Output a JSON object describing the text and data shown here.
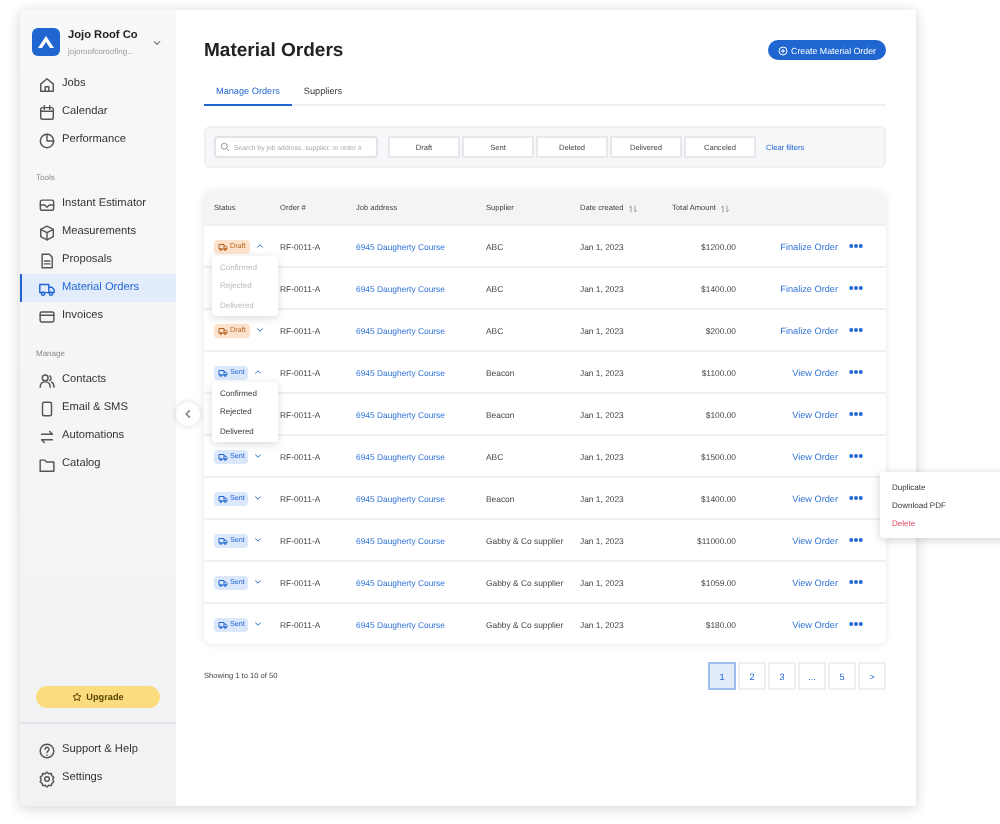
{
  "sidebar": {
    "company": "Jojo Roof Co",
    "subtitle": "jojoroofcoroofing...",
    "sections": [
      {
        "items": [
          {
            "label": "Jobs",
            "selected": false
          },
          {
            "label": "Calendar",
            "selected": false
          },
          {
            "label": "Performance",
            "selected": false
          }
        ]
      },
      {
        "heading": "Tools",
        "items": [
          {
            "label": "Instant Estimator",
            "selected": false
          },
          {
            "label": "Measurements",
            "selected": false
          },
          {
            "label": "Proposals",
            "selected": false
          },
          {
            "label": "Material Orders",
            "selected": true
          },
          {
            "label": "Invoices",
            "selected": false
          }
        ]
      },
      {
        "heading": "Manage",
        "items": [
          {
            "label": "Contacts",
            "selected": false
          },
          {
            "label": "Email & SMS",
            "selected": false
          },
          {
            "label": "Automations",
            "selected": false
          },
          {
            "label": "Catalog",
            "selected": false
          }
        ]
      }
    ],
    "upgrade": "Upgrade",
    "footer": [
      {
        "label": "Support & Help"
      },
      {
        "label": "Settings"
      }
    ]
  },
  "header": {
    "title": "Material Orders",
    "button": "Create Material Order"
  },
  "tabs": [
    {
      "label": "Manage Orders",
      "selected": true
    },
    {
      "label": "Suppliers",
      "selected": false
    }
  ],
  "filters": {
    "placeholder": "Search by job address, supplier, or order #",
    "options": [
      {
        "label": "Draft",
        "selected": false
      },
      {
        "label": "Sent",
        "selected": false
      },
      {
        "label": "Deleted",
        "selected": false
      },
      {
        "label": "Delivered",
        "selected": false
      },
      {
        "label": "Canceled",
        "selected": false
      }
    ],
    "clear": "Clear filters"
  },
  "table": {
    "columns": [
      {
        "label": "Status",
        "sortable": false
      },
      {
        "label": "Order #",
        "sortable": false
      },
      {
        "label": "Job address",
        "sortable": false
      },
      {
        "label": "Supplier",
        "sortable": false
      },
      {
        "label": "Date created",
        "sortable": true
      },
      {
        "label": "Total Amount",
        "sortable": true
      }
    ],
    "rows": [
      {
        "status": {
          "kind": "draft",
          "label": "Draft"
        },
        "expanded": true,
        "menu": [
          {
            "label": "Confirmed",
            "disabled": true
          },
          {
            "label": "Rejected",
            "disabled": true
          },
          {
            "label": "Delivered",
            "disabled": true
          }
        ],
        "order": "RF-0011-A",
        "address": "6945 Daugherty Course",
        "supplier": "ABC",
        "date": "Jan 1, 2023",
        "amount": "$1200.00",
        "action": "Finalize Order"
      },
      {
        "order": "RF-0011-A",
        "address": "6945 Daugherty Course",
        "supplier": "ABC",
        "date": "Jan 1, 2023",
        "amount": "$1400.00",
        "action": "Finalize Order"
      },
      {
        "status": {
          "kind": "draft",
          "label": "Draft"
        },
        "expanded": false,
        "order": "RF-0011-A",
        "address": "6945 Daugherty Course",
        "supplier": "ABC",
        "date": "Jan 1, 2023",
        "amount": "$200.00",
        "action": "Finalize Order"
      },
      {
        "status": {
          "kind": "sent",
          "label": "Sent"
        },
        "expanded": true,
        "menu": [
          {
            "label": "Confirmed",
            "disabled": false
          },
          {
            "label": "Rejected",
            "disabled": false
          },
          {
            "label": "Delivered",
            "disabled": false
          }
        ],
        "order": "RF-0011-A",
        "address": "6945 Daugherty Course",
        "supplier": "Beacon",
        "date": "Jan 1, 2023",
        "amount": "$1100.00",
        "action": "View Order"
      },
      {
        "order": "RF-0011-A",
        "address": "6945 Daugherty Course",
        "supplier": "Beacon",
        "date": "Jan 1, 2023",
        "amount": "$100.00",
        "action": "View Order"
      },
      {
        "status": {
          "kind": "sent",
          "label": "Sent"
        },
        "expanded": false,
        "order": "RF-0011-A",
        "address": "6945 Daugherty Course",
        "supplier": "ABC",
        "date": "Jan 1, 2023",
        "amount": "$1500.00",
        "action": "View Order",
        "actions_menu": [
          {
            "label": "Duplicate",
            "kind": "normal"
          },
          {
            "label": "Download PDF",
            "kind": "normal"
          },
          {
            "label": "Delete",
            "kind": "danger"
          }
        ]
      },
      {
        "status": {
          "kind": "sent",
          "label": "Sent"
        },
        "expanded": false,
        "order": "RF-0011-A",
        "address": "6945 Daugherty Course",
        "supplier": "Beacon",
        "date": "Jan 1, 2023",
        "amount": "$1400.00",
        "action": "View Order"
      },
      {
        "status": {
          "kind": "sent",
          "label": "Sent"
        },
        "expanded": false,
        "order": "RF-0011-A",
        "address": "6945 Daugherty Course",
        "supplier": "Gabby & Co supplier",
        "date": "Jan 1, 2023",
        "amount": "$11000.00",
        "action": "View Order"
      },
      {
        "status": {
          "kind": "sent",
          "label": "Sent"
        },
        "expanded": false,
        "order": "RF-0011-A",
        "address": "6945 Daugherty Course",
        "supplier": "Gabby & Co supplier",
        "date": "Jan 1, 2023",
        "amount": "$1059.00",
        "action": "View Order"
      },
      {
        "status": {
          "kind": "sent",
          "label": "Sent"
        },
        "expanded": false,
        "order": "RF-0011-A",
        "address": "6945 Daugherty Course",
        "supplier": "Gabby & Co supplier",
        "date": "Jan 1, 2023",
        "amount": "$180.00",
        "action": "View Order"
      }
    ]
  },
  "footer": {
    "showing": "Showing 1 to 10 of 50",
    "pages": [
      {
        "label": "1",
        "selected": true
      },
      {
        "label": "2",
        "selected": false
      },
      {
        "label": "3",
        "selected": false
      },
      {
        "label": "...",
        "selected": false
      },
      {
        "label": "5",
        "selected": false
      },
      {
        "label": ">",
        "selected": false
      }
    ]
  }
}
